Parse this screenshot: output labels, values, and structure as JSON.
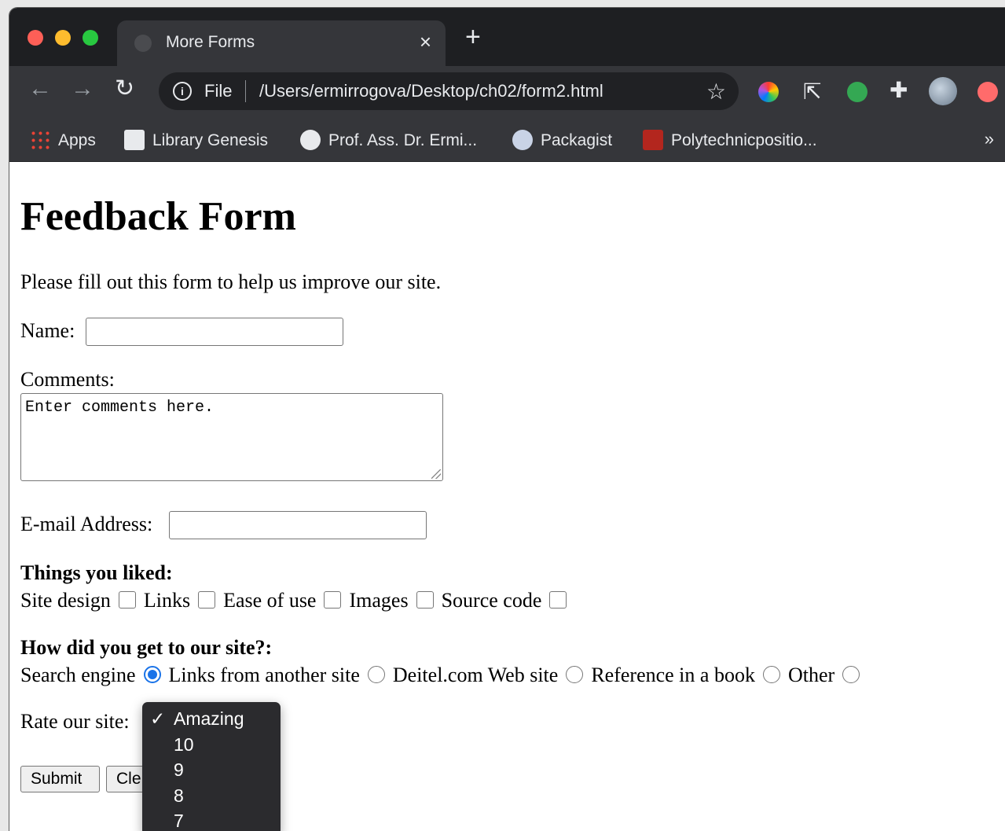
{
  "browser": {
    "tab_title": "More Forms",
    "tab_close": "×",
    "new_tab": "+",
    "url_scheme": "File",
    "url_path": "/Users/ermirrogova/Desktop/ch02/form2.html",
    "bookmarks": [
      {
        "label": "Apps"
      },
      {
        "label": "Library Genesis"
      },
      {
        "label": "Prof. Ass. Dr. Ermi..."
      },
      {
        "label": "Packagist"
      },
      {
        "label": "Polytechnicpositio..."
      }
    ],
    "more_bookmarks": "»"
  },
  "page": {
    "heading": "Feedback Form",
    "intro": "Please fill out this form to help us improve our site.",
    "name_label": "Name:",
    "comments_label": "Comments:",
    "comments_value": "Enter comments here.",
    "email_label": "E-mail Address:",
    "liked_heading": "Things you liked:",
    "liked_options": [
      "Site design",
      "Links",
      "Ease of use",
      "Images",
      "Source code"
    ],
    "source_heading": "How did you get to our site?:",
    "source_options": [
      "Search engine",
      "Links from another site",
      "Deitel.com Web site",
      "Reference in a book",
      "Other"
    ],
    "source_selected": "Search engine",
    "rate_label": "Rate our site:",
    "rate_options_visible": [
      "Amazing",
      "10",
      "9",
      "8",
      "7"
    ],
    "rate_selected": "Amazing",
    "submit_label": "Submit",
    "clear_label_visible": "Cle"
  },
  "colors": {
    "accent": "#1a73e8",
    "chrome_dark": "#35363a",
    "titlebar": "#1e1f22"
  }
}
